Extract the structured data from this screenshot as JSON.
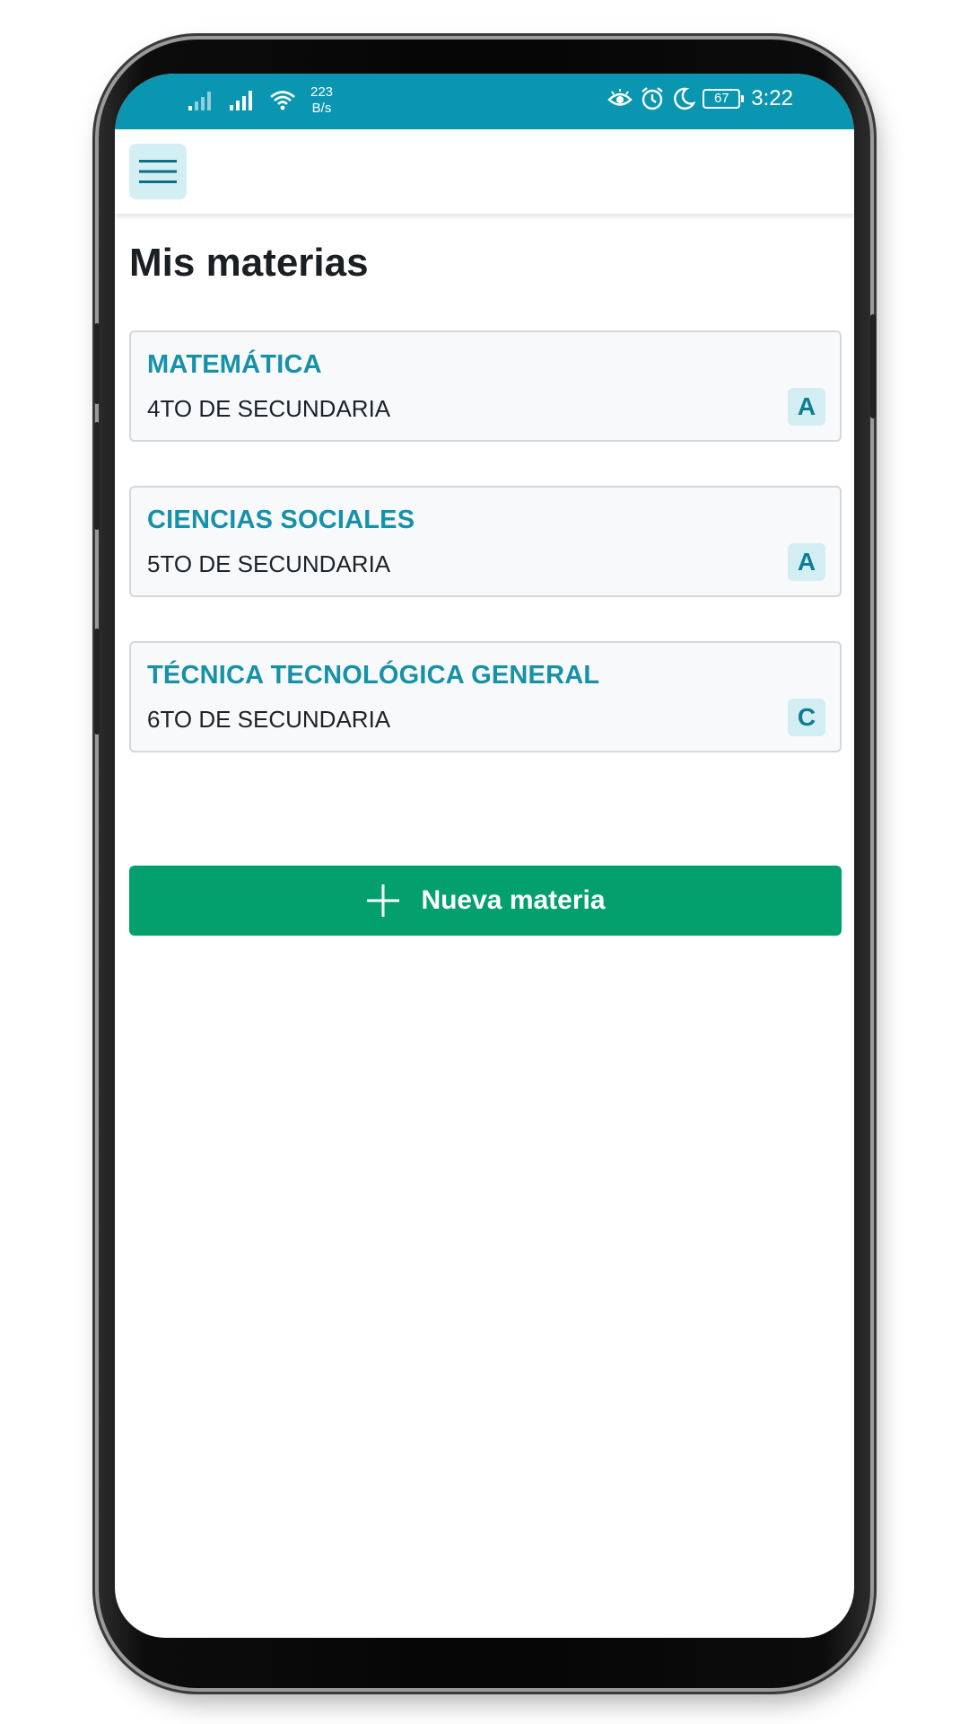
{
  "status_bar": {
    "net_speed_value": "223",
    "net_speed_unit": "B/s",
    "battery": "67",
    "time": "3:22",
    "background": "#0a96b0"
  },
  "app_bar": {
    "menu_icon": "hamburger-menu-icon"
  },
  "page": {
    "title": "Mis materias"
  },
  "subjects": [
    {
      "name": "MATEMÁTICA",
      "grade": "4TO DE SECUNDARIA",
      "section": "A"
    },
    {
      "name": "CIENCIAS SOCIALES",
      "grade": "5TO DE SECUNDARIA",
      "section": "A"
    },
    {
      "name": "TÉCNICA TECNOLÓGICA GENERAL",
      "grade": "6TO DE SECUNDARIA",
      "section": "C"
    }
  ],
  "new_subject_button": {
    "label": "Nueva materia",
    "icon": "plus-icon",
    "color": "#03a06d"
  },
  "colors": {
    "accent": "#1691a8",
    "badge_bg": "#d3eef3"
  }
}
